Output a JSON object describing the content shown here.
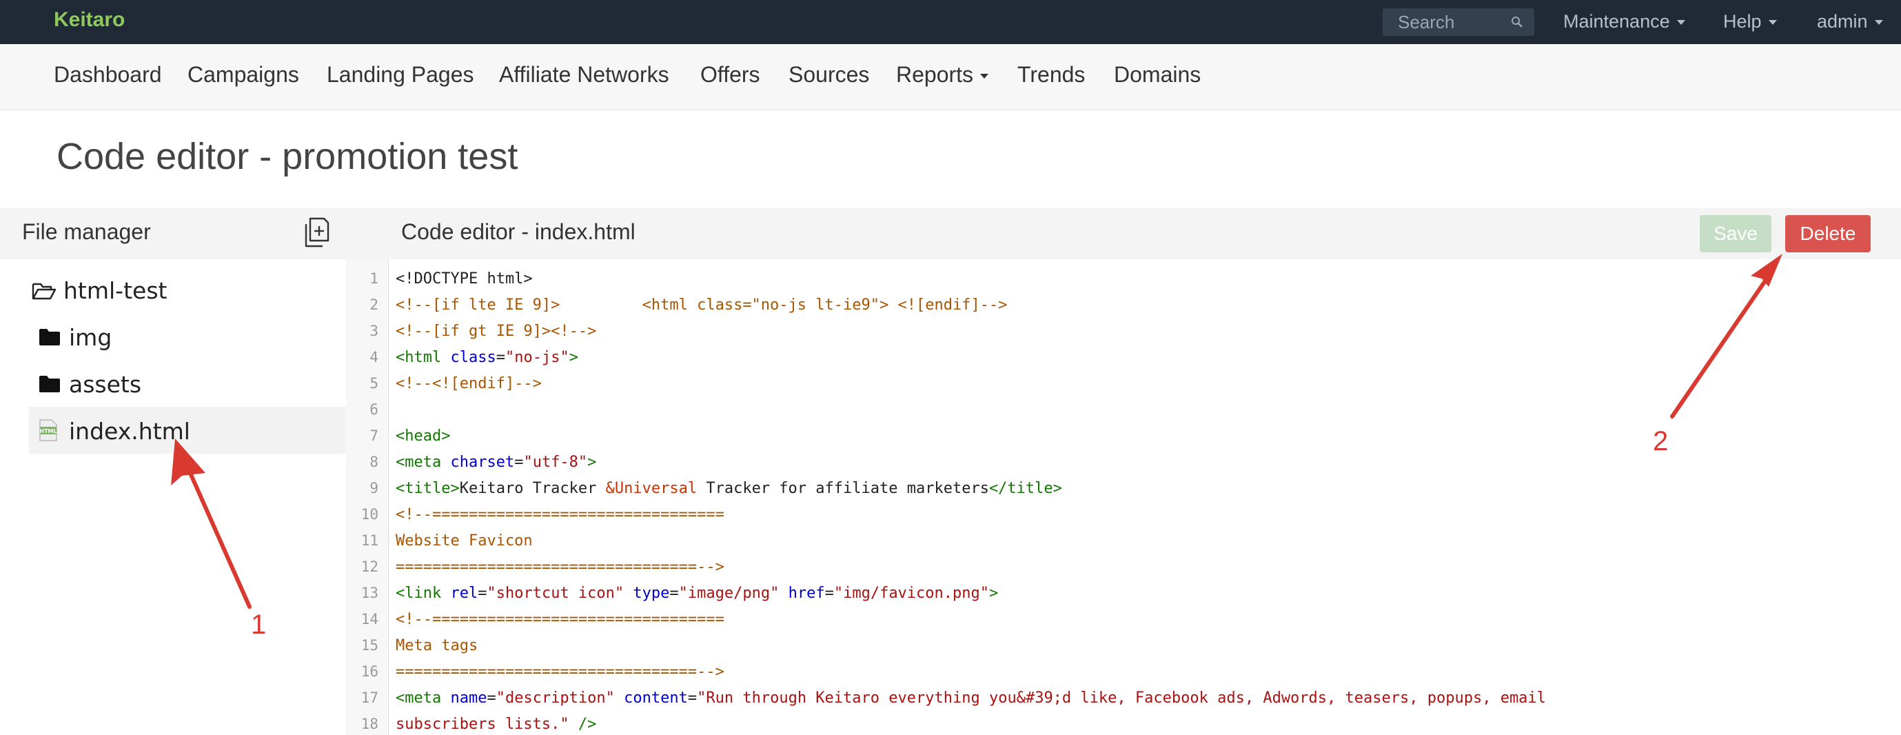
{
  "topbar": {
    "brand": "Keitaro",
    "search_placeholder": "Search",
    "menus": [
      "Maintenance",
      "Help",
      "admin"
    ]
  },
  "nav": {
    "items": [
      "Dashboard",
      "Campaigns",
      "Landing Pages",
      "Affiliate Networks",
      "Offers",
      "Sources",
      "Reports",
      "Trends",
      "Domains"
    ]
  },
  "page": {
    "title": "Code editor - promotion test"
  },
  "file_manager": {
    "title": "File manager",
    "files": [
      {
        "name": "html-test",
        "type": "folder-open"
      },
      {
        "name": "img",
        "type": "folder"
      },
      {
        "name": "assets",
        "type": "folder"
      },
      {
        "name": "index.html",
        "type": "html-file",
        "badge": "HTML"
      }
    ]
  },
  "editor": {
    "title": "Code editor - index.html",
    "save_label": "Save",
    "delete_label": "Delete",
    "line_numbers": [
      "1",
      "2",
      "3",
      "4",
      "5",
      "6",
      "7",
      "8",
      "9",
      "10",
      "11",
      "12",
      "13",
      "14",
      "15",
      "16",
      "17",
      "18"
    ],
    "lines": [
      [
        [
          "txt",
          "<!DOCTYPE html>"
        ]
      ],
      [
        [
          "com",
          "<!--[if lte IE 9]>         <html class=\"no-js lt-ie9\"> <![endif]-->"
        ]
      ],
      [
        [
          "com",
          "<!--[if gt IE 9]><!-->"
        ]
      ],
      [
        [
          "tag",
          "<html "
        ],
        [
          "att",
          "class"
        ],
        [
          "txt",
          "="
        ],
        [
          "str",
          "\"no-js\""
        ],
        [
          "tag",
          ">"
        ]
      ],
      [
        [
          "com",
          "<!--<![endif]-->"
        ]
      ],
      [],
      [
        [
          "tag",
          "<head>"
        ]
      ],
      [
        [
          "tag",
          "<meta "
        ],
        [
          "att",
          "charset"
        ],
        [
          "txt",
          "="
        ],
        [
          "str",
          "\"utf-8\""
        ],
        [
          "tag",
          ">"
        ]
      ],
      [
        [
          "tag",
          "<title>"
        ],
        [
          "txt",
          "Keitaro Tracker "
        ],
        [
          "ent",
          "&Universal"
        ],
        [
          "txt",
          " Tracker for affiliate marketers"
        ],
        [
          "tag",
          "</title>"
        ]
      ],
      [
        [
          "com",
          "<!--================================"
        ]
      ],
      [
        [
          "com",
          "Website Favicon"
        ]
      ],
      [
        [
          "com",
          "=================================-->"
        ]
      ],
      [
        [
          "tag",
          "<link "
        ],
        [
          "att",
          "rel"
        ],
        [
          "txt",
          "="
        ],
        [
          "str",
          "\"shortcut icon\""
        ],
        [
          "txt",
          " "
        ],
        [
          "att",
          "type"
        ],
        [
          "txt",
          "="
        ],
        [
          "str",
          "\"image/png\""
        ],
        [
          "txt",
          " "
        ],
        [
          "att",
          "href"
        ],
        [
          "txt",
          "="
        ],
        [
          "str",
          "\"img/favicon.png\""
        ],
        [
          "tag",
          ">"
        ]
      ],
      [
        [
          "com",
          "<!--================================"
        ]
      ],
      [
        [
          "com",
          "Meta tags"
        ]
      ],
      [
        [
          "com",
          "=================================-->"
        ]
      ],
      [
        [
          "tag",
          "<meta "
        ],
        [
          "att",
          "name"
        ],
        [
          "txt",
          "="
        ],
        [
          "str",
          "\"description\""
        ],
        [
          "txt",
          " "
        ],
        [
          "att",
          "content"
        ],
        [
          "txt",
          "="
        ],
        [
          "str",
          "\"Run through Keitaro everything you&#39;d like, Facebook ads, Adwords, teasers, popups, email"
        ]
      ],
      [
        [
          "str",
          "subscribers lists.\""
        ],
        [
          "txt",
          " "
        ],
        [
          "tag",
          "/>"
        ]
      ]
    ]
  },
  "annotations": [
    "1",
    "2"
  ],
  "colors": {
    "topbar_bg": "#1f2a36",
    "brand": "#8fc95e",
    "delete": "#d9534f",
    "save_disabled": "#c5dec5",
    "annotation": "#d93a30"
  }
}
